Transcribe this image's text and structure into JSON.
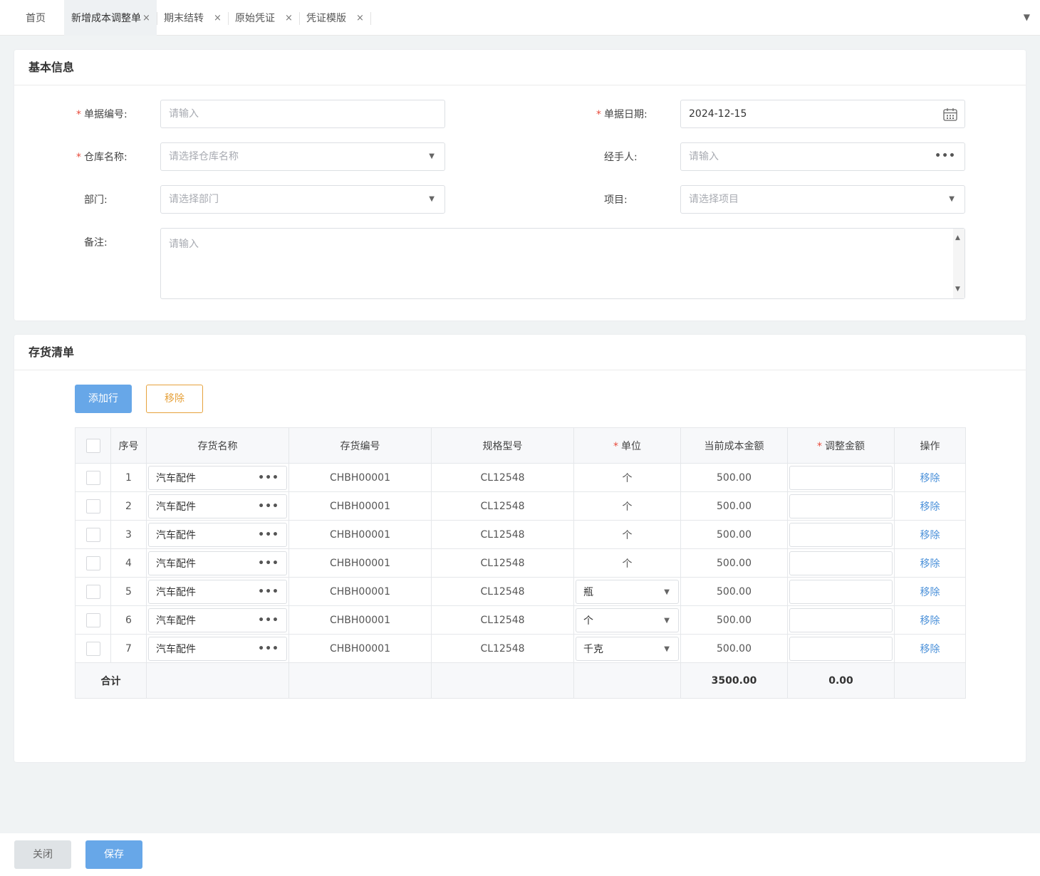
{
  "tabs": [
    {
      "label": "首页",
      "closable": false,
      "active": false
    },
    {
      "label": "新增成本调整单",
      "closable": true,
      "active": true
    },
    {
      "label": "期末结转",
      "closable": true,
      "active": false
    },
    {
      "label": "原始凭证",
      "closable": true,
      "active": false
    },
    {
      "label": "凭证模版",
      "closable": true,
      "active": false
    }
  ],
  "tab_close_glyph": "×",
  "tab_menu_glyph": "▼",
  "basic": {
    "title": "基本信息",
    "doc_no": {
      "label": "单据编号:",
      "placeholder": "请输入",
      "required": true
    },
    "doc_date": {
      "label": "单据日期:",
      "value": "2024-12-15",
      "required": true
    },
    "warehouse": {
      "label": "仓库名称:",
      "placeholder": "请选择仓库名称",
      "required": true
    },
    "handler": {
      "label": "经手人:",
      "placeholder": "请输入"
    },
    "department": {
      "label": "部门:",
      "placeholder": "请选择部门"
    },
    "project": {
      "label": "项目:",
      "placeholder": "请选择项目"
    },
    "remark": {
      "label": "备注:",
      "placeholder": "请输入"
    }
  },
  "inventory": {
    "title": "存货清单",
    "add_row_label": "添加行",
    "remove_label": "移除",
    "columns": {
      "index": "序号",
      "name": "存货名称",
      "code": "存货编号",
      "spec": "规格型号",
      "unit": "单位",
      "current_cost": "当前成本金额",
      "adjust_amount": "调整金额",
      "action": "操作"
    },
    "row_action_label": "移除",
    "rows": [
      {
        "index": "1",
        "name": "汽车配件",
        "code": "CHBH00001",
        "spec": "CL12548",
        "unit": "个",
        "unit_select": false,
        "current_cost": "500.00"
      },
      {
        "index": "2",
        "name": "汽车配件",
        "code": "CHBH00001",
        "spec": "CL12548",
        "unit": "个",
        "unit_select": false,
        "current_cost": "500.00"
      },
      {
        "index": "3",
        "name": "汽车配件",
        "code": "CHBH00001",
        "spec": "CL12548",
        "unit": "个",
        "unit_select": false,
        "current_cost": "500.00"
      },
      {
        "index": "4",
        "name": "汽车配件",
        "code": "CHBH00001",
        "spec": "CL12548",
        "unit": "个",
        "unit_select": false,
        "current_cost": "500.00"
      },
      {
        "index": "5",
        "name": "汽车配件",
        "code": "CHBH00001",
        "spec": "CL12548",
        "unit": "瓶",
        "unit_select": true,
        "current_cost": "500.00"
      },
      {
        "index": "6",
        "name": "汽车配件",
        "code": "CHBH00001",
        "spec": "CL12548",
        "unit": "个",
        "unit_select": true,
        "current_cost": "500.00"
      },
      {
        "index": "7",
        "name": "汽车配件",
        "code": "CHBH00001",
        "spec": "CL12548",
        "unit": "千克",
        "unit_select": true,
        "current_cost": "500.00"
      }
    ],
    "total": {
      "label": "合计",
      "current_cost": "3500.00",
      "adjust_amount": "0.00"
    }
  },
  "footer": {
    "close_label": "关闭",
    "save_label": "保存"
  },
  "colors": {
    "primary": "#67a7e8",
    "warning": "#e6a23c",
    "required": "#e84b3c",
    "link": "#4a90d9"
  }
}
